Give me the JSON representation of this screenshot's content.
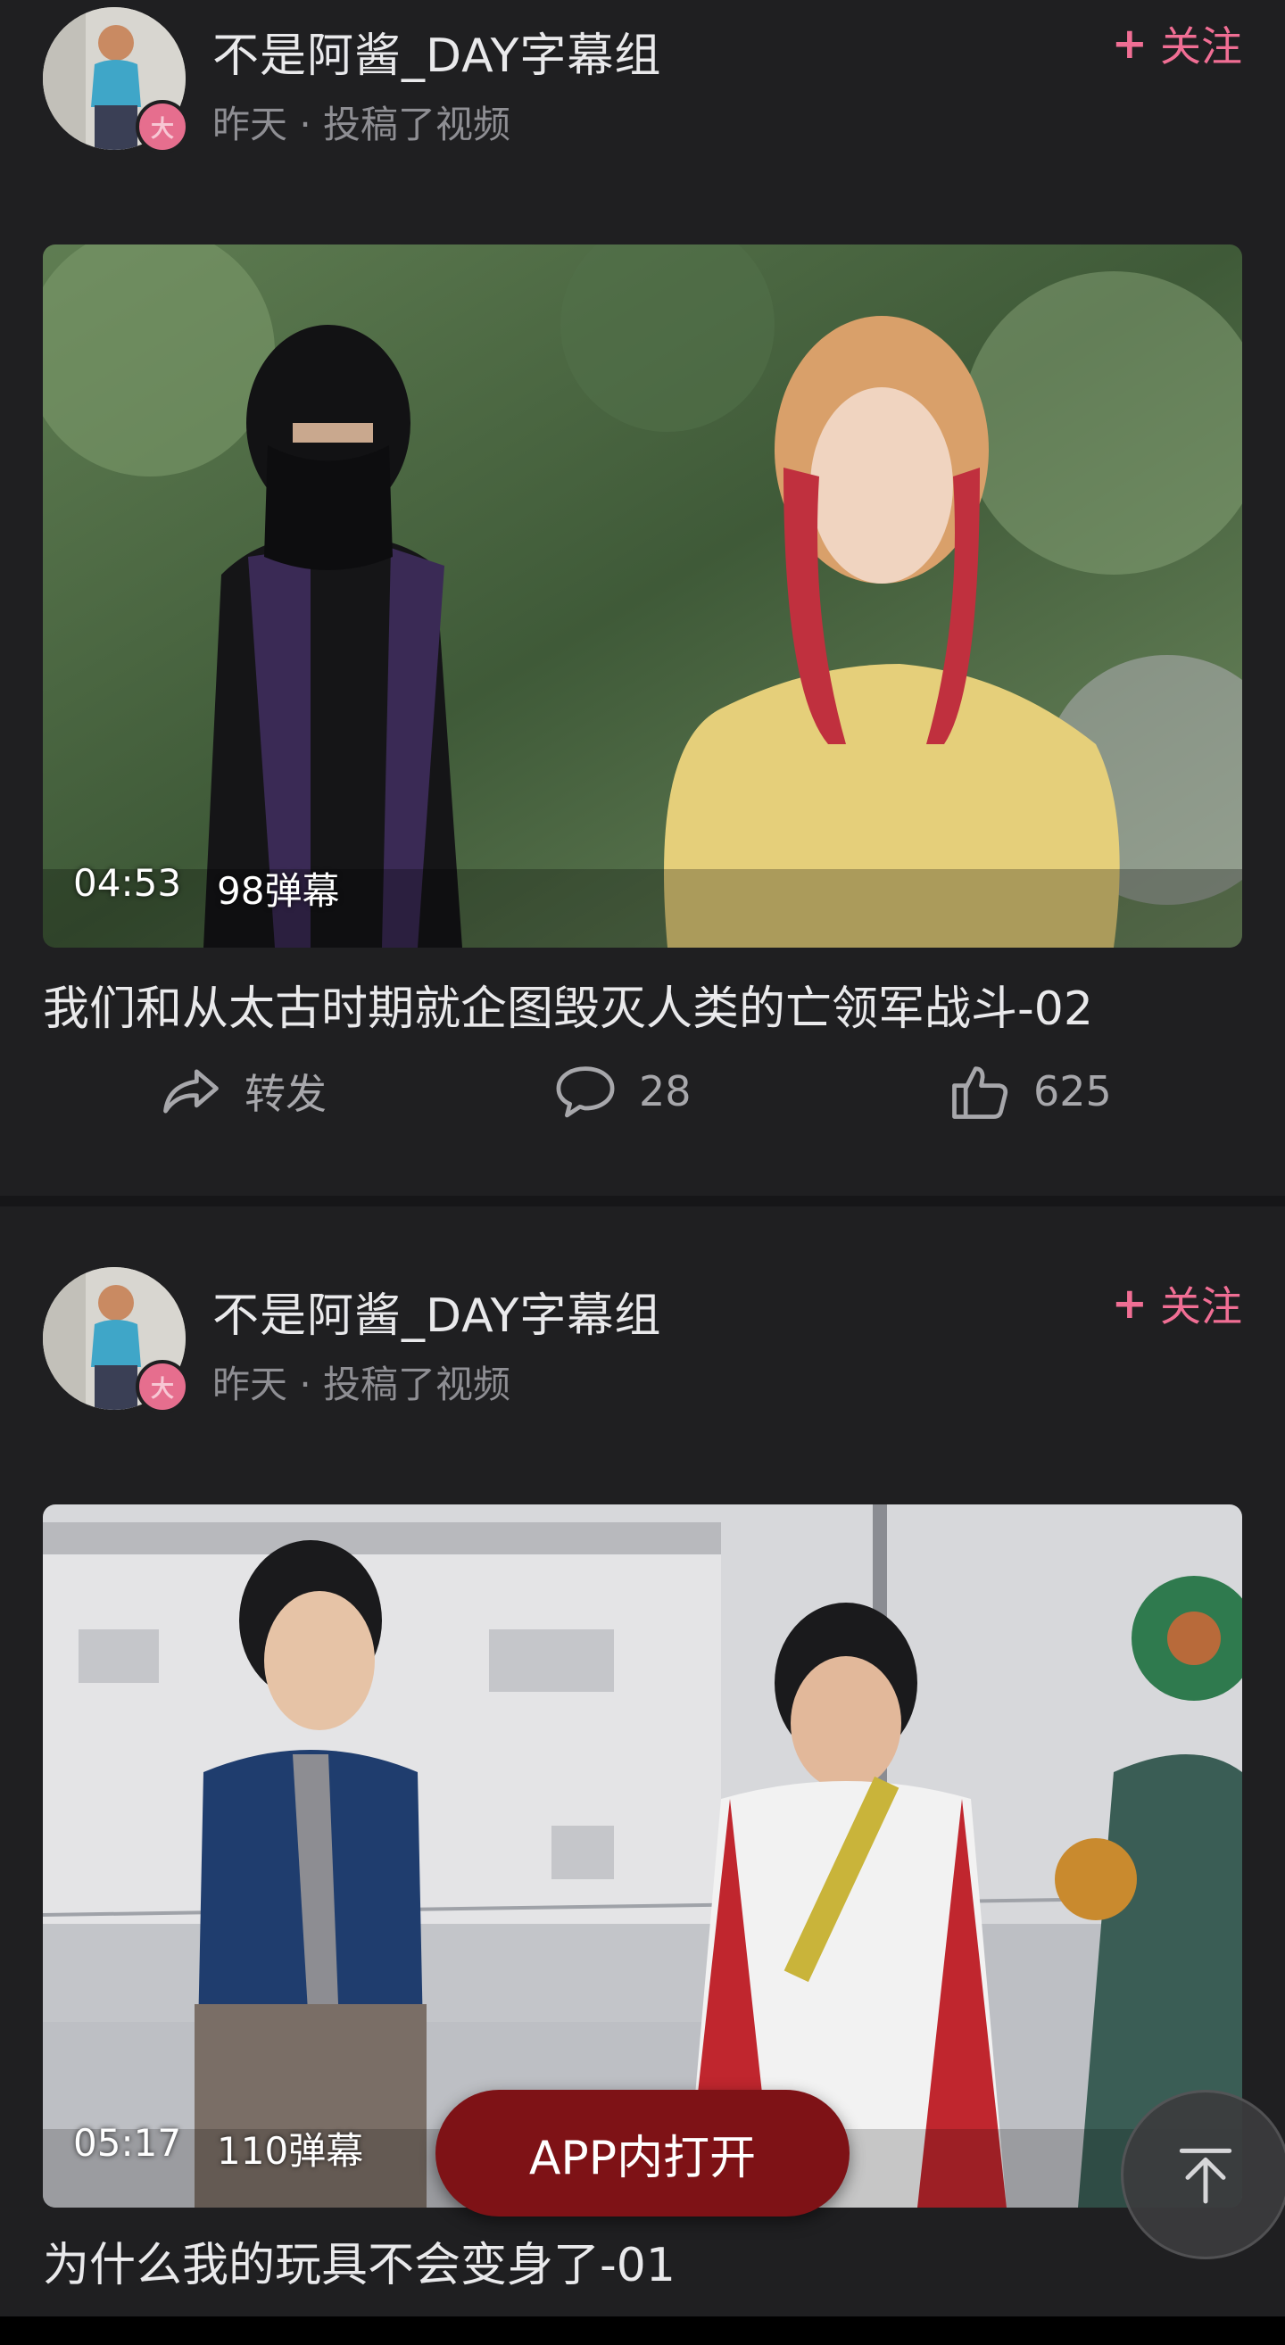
{
  "theme": {
    "background": "#1f1f21",
    "accent_follow": "#f06e94",
    "open_app_button": "#7e1216"
  },
  "posts": [
    {
      "author": "不是阿酱_DAY字幕组",
      "meta": "昨天 · 投稿了视频",
      "follow_label": "关注",
      "follow_icon": "plus-icon",
      "duration": "04:53",
      "danmaku": "98弹幕",
      "title": "我们和从太古时期就企图毁灭人类的亡领军战斗-02",
      "share_label": "转发",
      "comments": "28",
      "likes": "625"
    },
    {
      "author": "不是阿酱_DAY字幕组",
      "meta": "昨天 · 投稿了视频",
      "follow_label": "关注",
      "follow_icon": "plus-icon",
      "duration": "05:17",
      "danmaku": "110弹幕",
      "title": "为什么我的玩具不会变身了-01"
    }
  ],
  "floating": {
    "open_app_label": "APP内打开",
    "to_top_icon": "arrow-up-to-top-icon"
  }
}
